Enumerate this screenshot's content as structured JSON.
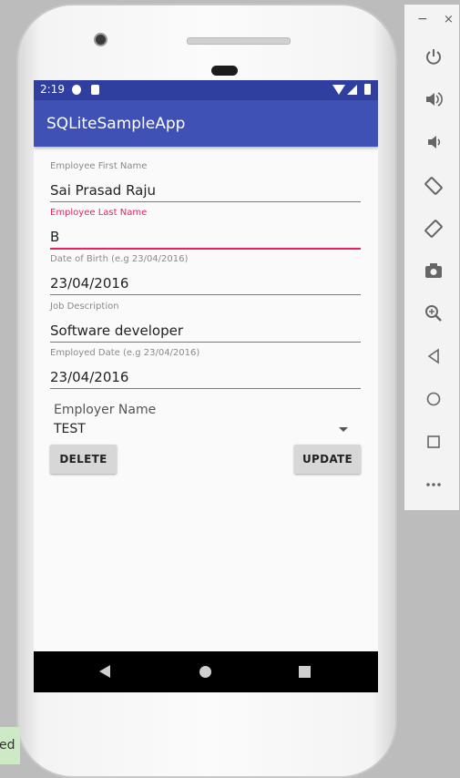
{
  "status_bar": {
    "time": "2:19"
  },
  "app_bar": {
    "title": "SQLiteSampleApp"
  },
  "form": {
    "fields": [
      {
        "label": "Employee First Name",
        "value": "Sai Prasad Raju"
      },
      {
        "label": "Employee Last Name",
        "value": "B"
      },
      {
        "label": "Date of Birth (e.g 23/04/2016)",
        "value": "23/04/2016"
      },
      {
        "label": "Job Description",
        "value": "Software developer"
      },
      {
        "label": "Employed Date (e.g 23/04/2016)",
        "value": "23/04/2016"
      }
    ],
    "employer_label": "Employer Name",
    "employer_value": "TEST"
  },
  "buttons": {
    "delete": "DELETE",
    "update": "UPDATE"
  },
  "emulator_toolbar": {
    "minimize": "−",
    "close": "×",
    "tools": [
      "power-icon",
      "volume-up-icon",
      "volume-down-icon",
      "rotate-left-icon",
      "rotate-right-icon",
      "camera-icon",
      "zoom-icon",
      "back-icon",
      "home-icon",
      "overview-icon",
      "more-icon"
    ]
  },
  "toast": {
    "text": "ed in"
  },
  "colors": {
    "primary": "#3f51b5",
    "primary_dark": "#303f9f",
    "accent": "#e91e63"
  }
}
